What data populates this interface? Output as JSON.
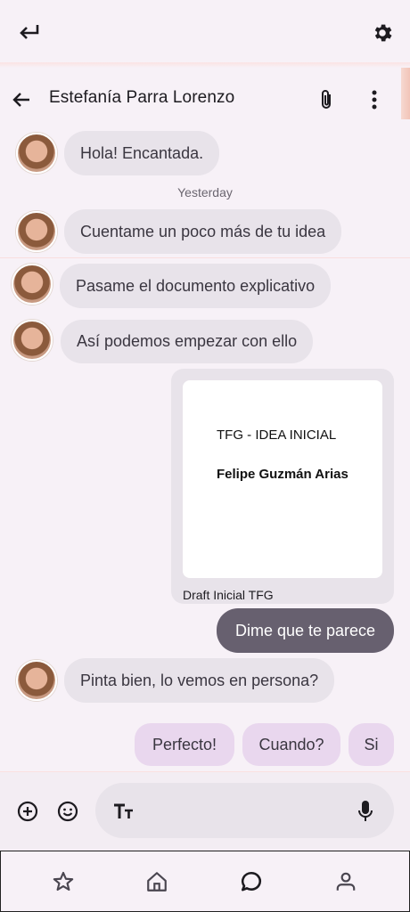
{
  "top_bar": {
    "back_icon": "return-arrow-icon",
    "settings_icon": "gear-icon"
  },
  "chat_header": {
    "back_icon": "arrow-left-icon",
    "title": "Estefanía Parra Lorenzo",
    "attach_icon": "paperclip-icon",
    "menu_icon": "more-vertical-icon"
  },
  "messages": [
    {
      "from": "contact",
      "text": "Hola! Encantada."
    },
    {
      "type": "timestamp",
      "text": "Yesterday"
    },
    {
      "from": "contact",
      "text": "Cuentame un poco más de tu idea"
    },
    {
      "from": "contact",
      "text": "Pasame el documento explicativo"
    },
    {
      "from": "contact",
      "text": "Así podemos empezar con ello"
    },
    {
      "from": "me",
      "type": "document",
      "doc_title": "TFG - IDEA INICIAL",
      "doc_author": "Felipe Guzmán Arias",
      "caption": "Draft Inicial TFG"
    },
    {
      "from": "me",
      "text": "Dime que te parece"
    },
    {
      "from": "contact",
      "text": "Pinta bien, lo vemos en persona?"
    }
  ],
  "quick_replies": [
    "Perfecto!",
    "Cuando?",
    "Si"
  ],
  "composer": {
    "add_icon": "add-circle-icon",
    "emoji_icon": "emoji-icon",
    "text_format_icon": "text-format-icon",
    "mic_icon": "mic-icon"
  },
  "bottom_nav": [
    "star-icon",
    "home-icon",
    "chat-icon",
    "person-icon"
  ],
  "colors": {
    "background": "#f7f1f7",
    "bubble": "#e8e3ea",
    "sent_bubble": "#67606f",
    "chip": "#e9d7ee"
  }
}
